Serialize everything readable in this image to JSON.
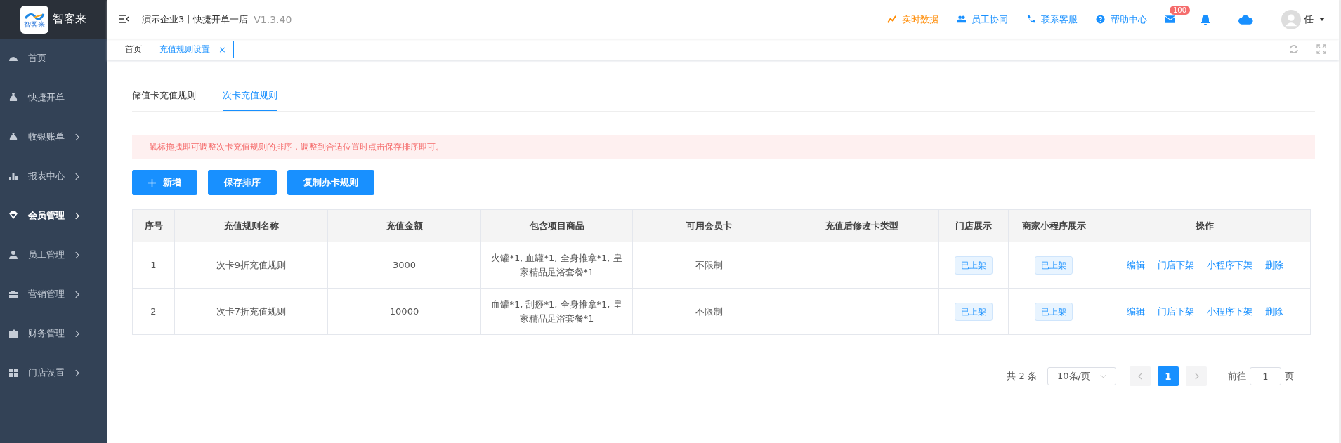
{
  "brand": {
    "logo_text": "智客来",
    "name": "智客来"
  },
  "sidebar": {
    "items": [
      {
        "label": "首页",
        "has_children": false,
        "selected": false
      },
      {
        "label": "快捷开单",
        "has_children": false,
        "selected": false
      },
      {
        "label": "收银账单",
        "has_children": true,
        "selected": false
      },
      {
        "label": "报表中心",
        "has_children": true,
        "selected": false
      },
      {
        "label": "会员管理",
        "has_children": true,
        "selected": true
      },
      {
        "label": "员工管理",
        "has_children": true,
        "selected": false
      },
      {
        "label": "营销管理",
        "has_children": true,
        "selected": false
      },
      {
        "label": "财务管理",
        "has_children": true,
        "selected": false
      },
      {
        "label": "门店设置",
        "has_children": true,
        "selected": false
      }
    ]
  },
  "header": {
    "store": "演示企业3丨快捷开单一店",
    "version": "V1.3.40",
    "links": [
      {
        "label": "实时数据",
        "highlight": true
      },
      {
        "label": "员工协同",
        "highlight": false
      },
      {
        "label": "联系客服",
        "highlight": false
      },
      {
        "label": "帮助中心",
        "highlight": false
      }
    ],
    "mail_badge": "100",
    "user": "任"
  },
  "page_tabs": [
    {
      "label": "首页",
      "selected": false,
      "closable": false
    },
    {
      "label": "充值规则设置",
      "selected": true,
      "closable": true,
      "close": "×"
    }
  ],
  "tabs": [
    {
      "label": "储值卡充值规则",
      "selected": false
    },
    {
      "label": "次卡充值规则",
      "selected": true
    }
  ],
  "alert": "鼠标拖拽即可调整次卡充值规则的排序，调整到合适位置时点击保存排序即可。",
  "buttons": [
    {
      "label": "新增"
    },
    {
      "label": "保存排序"
    },
    {
      "label": "复制办卡规则"
    }
  ],
  "table": {
    "columns": [
      "序号",
      "充值规则名称",
      "充值金额",
      "包含项目商品",
      "可用会员卡",
      "充值后修改卡类型",
      "门店展示",
      "商家小程序展示",
      "操作"
    ],
    "rows": [
      {
        "index": "1",
        "name": "次卡9折充值规则",
        "amount": "3000",
        "items": "火罐*1, 血罐*1, 全身推拿*1, 皇家精品足浴套餐*1",
        "cards": "不限制",
        "store_status": "已上架",
        "mini_status": "已上架",
        "actions": [
          "编辑",
          "门店下架",
          "小程序下架",
          "删除"
        ]
      },
      {
        "index": "2",
        "name": "次卡7折充值规则",
        "amount": "10000",
        "items": "血罐*1, 刮痧*1, 全身推拿*1, 皇家精品足浴套餐*1",
        "cards": "不限制",
        "store_status": "已上架",
        "mini_status": "已上架",
        "actions": [
          "编辑",
          "门店下架",
          "小程序下架",
          "删除"
        ]
      }
    ]
  },
  "pagination": {
    "total": "共 2 条",
    "page_size": "10条/页",
    "pages": [
      {
        "label": "1",
        "selected": true
      }
    ],
    "goto_label": "前往",
    "goto_value": "1",
    "page_unit": "页"
  }
}
